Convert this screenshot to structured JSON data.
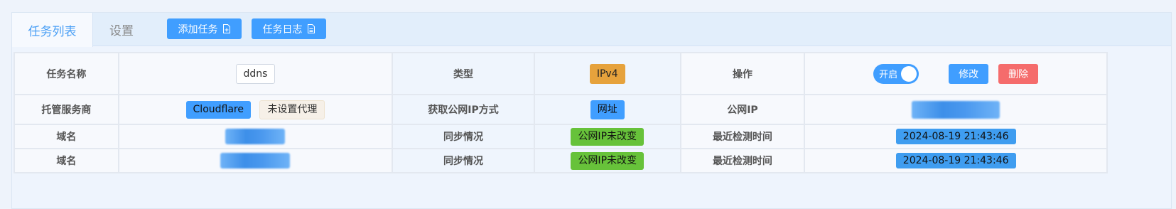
{
  "tabs": [
    {
      "label": "任务列表",
      "active": true
    },
    {
      "label": "设置",
      "active": false
    }
  ],
  "toolbar": {
    "add_task_label": "添加任务",
    "task_log_label": "任务日志"
  },
  "task": {
    "name_label": "任务名称",
    "name_value": "ddns",
    "type_label": "类型",
    "type_value": "IPv4",
    "ops_label": "操作",
    "switch_label": "开启",
    "switch_on": true,
    "edit_label": "修改",
    "delete_label": "删除",
    "provider_label": "托管服务商",
    "provider_value": "Cloudflare",
    "proxy_value": "未设置代理",
    "ip_method_label": "获取公网IP方式",
    "ip_method_value": "网址",
    "public_ip_label": "公网IP",
    "domains": [
      {
        "label": "域名",
        "sync_label": "同步情况",
        "sync_status": "公网IP未改变",
        "check_label": "最近检测时间",
        "check_time": "2024-08-19 21:43:46"
      },
      {
        "label": "域名",
        "sync_label": "同步情况",
        "sync_status": "公网IP未改变",
        "check_label": "最近检测时间",
        "check_time": "2024-08-19 21:43:46"
      }
    ]
  },
  "colors": {
    "primary": "#409eff",
    "danger": "#f56c6c",
    "warning": "#e6a23c",
    "success": "#67c23a"
  }
}
